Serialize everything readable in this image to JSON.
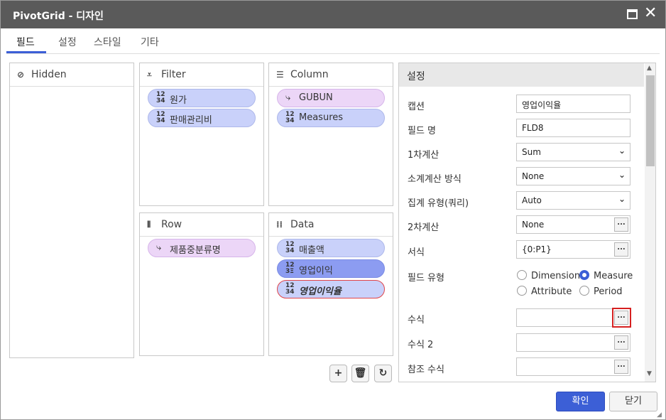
{
  "window": {
    "title": "PivotGrid - 디자인"
  },
  "tabs": [
    {
      "label": "필드"
    },
    {
      "label": "설정"
    },
    {
      "label": "스타일"
    },
    {
      "label": "기타"
    }
  ],
  "panels": {
    "hidden": {
      "title": "Hidden",
      "icon": "eye-slash-icon"
    },
    "filter": {
      "title": "Filter",
      "icon": "filter-icon",
      "items": [
        {
          "label": "원가",
          "icon": "numeric-icon"
        },
        {
          "label": "판매관리비",
          "icon": "numeric-icon"
        }
      ]
    },
    "column": {
      "title": "Column",
      "icon": "list-icon",
      "items": [
        {
          "label": "GUBUN",
          "icon": "hierarchy-icon"
        },
        {
          "label": "Measures",
          "icon": "numeric-icon"
        }
      ]
    },
    "row": {
      "title": "Row",
      "icon": "columns-icon",
      "items": [
        {
          "label": "제품중분류명",
          "icon": "hierarchy-icon"
        }
      ]
    },
    "data": {
      "title": "Data",
      "icon": "grid-dots-icon",
      "items": [
        {
          "label": "매출액",
          "icon": "numeric-icon"
        },
        {
          "label": "영업이익",
          "icon": "calc-numeric-icon"
        },
        {
          "label": "영업이익율",
          "icon": "numeric-icon"
        }
      ]
    }
  },
  "settings": {
    "header": "설정",
    "caption_label": "캡션",
    "caption_value": "영업이익율",
    "field_name_label": "필드 명",
    "field_name_value": "FLD8",
    "calc1_label": "1차계산",
    "calc1_value": "Sum",
    "subtotal_label": "소계계산 방식",
    "subtotal_value": "None",
    "agg_label": "집계 유형(쿼리)",
    "agg_value": "Auto",
    "calc2_label": "2차계산",
    "calc2_value": "None",
    "format_label": "서식",
    "format_value": "{0:P1}",
    "field_type_label": "필드 유형",
    "field_type_options": [
      "Dimension",
      "Measure",
      "Attribute",
      "Period"
    ],
    "field_type_selected": "Measure",
    "formula_label": "수식",
    "formula_value": "",
    "formula2_label": "수식 2",
    "formula2_value": "",
    "ref_formula_label": "참조 수식",
    "ref_formula_value": "",
    "ellipsis": "..."
  },
  "toolbar": {
    "add": "+",
    "delete": "🗑",
    "refresh": "↻"
  },
  "footer": {
    "ok": "확인",
    "close": "닫기"
  }
}
